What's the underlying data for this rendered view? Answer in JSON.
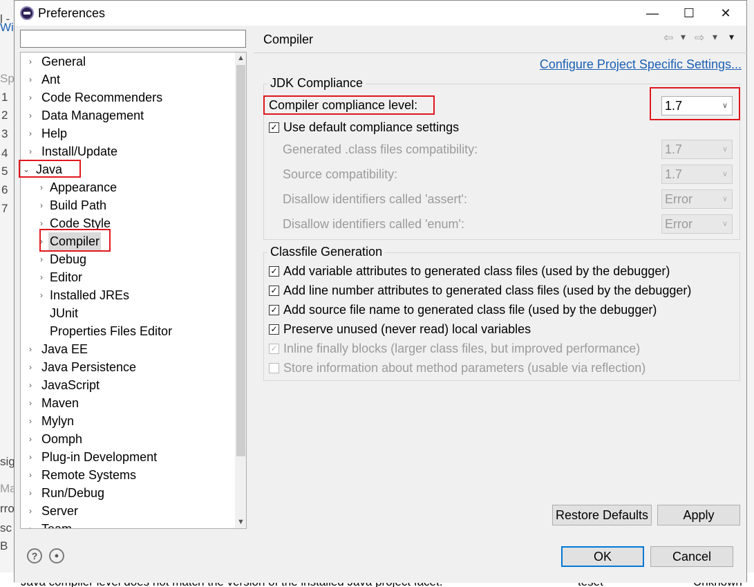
{
  "background": {
    "left_fragments": [
      "l -",
      "Wi",
      "Spr",
      "1",
      "2",
      "3",
      "4",
      "5",
      "6",
      "7",
      "sig",
      "Ma",
      "rro",
      "sc",
      "B"
    ],
    "status_text": "Java compiler level does not match the version of the installed Java project facet.",
    "status_col2": "teset",
    "status_col3": "Unknown"
  },
  "window": {
    "title": "Preferences",
    "minimize": "—",
    "maximize": "☐",
    "close": "✕"
  },
  "filter": {
    "value": "",
    "placeholder": ""
  },
  "tree": {
    "items": [
      {
        "label": "General",
        "level": 0,
        "expand": "›"
      },
      {
        "label": "Ant",
        "level": 0,
        "expand": "›"
      },
      {
        "label": "Code Recommenders",
        "level": 0,
        "expand": "›"
      },
      {
        "label": "Data Management",
        "level": 0,
        "expand": "›"
      },
      {
        "label": "Help",
        "level": 0,
        "expand": "›"
      },
      {
        "label": "Install/Update",
        "level": 0,
        "expand": "›"
      },
      {
        "label": "Java",
        "level": 0,
        "expand": "⌄"
      },
      {
        "label": "Appearance",
        "level": 1,
        "expand": "›"
      },
      {
        "label": "Build Path",
        "level": 1,
        "expand": "›"
      },
      {
        "label": "Code Style",
        "level": 1,
        "expand": "›"
      },
      {
        "label": "Compiler",
        "level": 1,
        "expand": "›",
        "selected": true
      },
      {
        "label": "Debug",
        "level": 1,
        "expand": "›"
      },
      {
        "label": "Editor",
        "level": 1,
        "expand": "›"
      },
      {
        "label": "Installed JREs",
        "level": 1,
        "expand": "›"
      },
      {
        "label": "JUnit",
        "level": 1,
        "expand": ""
      },
      {
        "label": "Properties Files Editor",
        "level": 1,
        "expand": ""
      },
      {
        "label": "Java EE",
        "level": 0,
        "expand": "›"
      },
      {
        "label": "Java Persistence",
        "level": 0,
        "expand": "›"
      },
      {
        "label": "JavaScript",
        "level": 0,
        "expand": "›"
      },
      {
        "label": "Maven",
        "level": 0,
        "expand": "›"
      },
      {
        "label": "Mylyn",
        "level": 0,
        "expand": "›"
      },
      {
        "label": "Oomph",
        "level": 0,
        "expand": "›"
      },
      {
        "label": "Plug-in Development",
        "level": 0,
        "expand": "›"
      },
      {
        "label": "Remote Systems",
        "level": 0,
        "expand": "›"
      },
      {
        "label": "Run/Debug",
        "level": 0,
        "expand": "›"
      },
      {
        "label": "Server",
        "level": 0,
        "expand": "›"
      },
      {
        "label": "Team",
        "level": 0,
        "expand": "›"
      }
    ],
    "scroll_up": "▲",
    "scroll_down": "▼"
  },
  "page": {
    "title": "Compiler",
    "nav_back": "⇦",
    "nav_back_menu": "▾",
    "nav_forward": "⇨",
    "nav_forward_menu": "▾",
    "view_menu": "▾",
    "configure_link": "Configure Project Specific Settings...",
    "jdk_group": {
      "title": "JDK Compliance",
      "compliance_label": "Compiler compliance level:",
      "compliance_value": "1.7",
      "use_default_label": "Use default compliance settings",
      "use_default_checked": true,
      "rows": [
        {
          "label": "Generated .class files compatibility:",
          "value": "1.7"
        },
        {
          "label": "Source compatibility:",
          "value": "1.7"
        },
        {
          "label": "Disallow identifiers called 'assert':",
          "value": "Error"
        },
        {
          "label": "Disallow identifiers called 'enum':",
          "value": "Error"
        }
      ]
    },
    "classfile_group": {
      "title": "Classfile Generation",
      "options": [
        {
          "label": "Add variable attributes to generated class files (used by the debugger)",
          "checked": true,
          "enabled": true
        },
        {
          "label": "Add line number attributes to generated class files (used by the debugger)",
          "checked": true,
          "enabled": true
        },
        {
          "label": "Add source file name to generated class file (used by the debugger)",
          "checked": true,
          "enabled": true
        },
        {
          "label": "Preserve unused (never read) local variables",
          "checked": true,
          "enabled": true
        },
        {
          "label": "Inline finally blocks (larger class files, but improved performance)",
          "checked": true,
          "enabled": false
        },
        {
          "label": "Store information about method parameters (usable via reflection)",
          "checked": false,
          "enabled": false
        }
      ]
    },
    "restore_defaults": "Restore Defaults",
    "apply": "Apply"
  },
  "footer": {
    "help_icon": "?",
    "import_export_icon": "●",
    "ok": "OK",
    "cancel": "Cancel"
  },
  "colors": {
    "highlight_box": "#e0161b",
    "link": "#1a5fb4",
    "default_button_border": "#0078d7"
  }
}
